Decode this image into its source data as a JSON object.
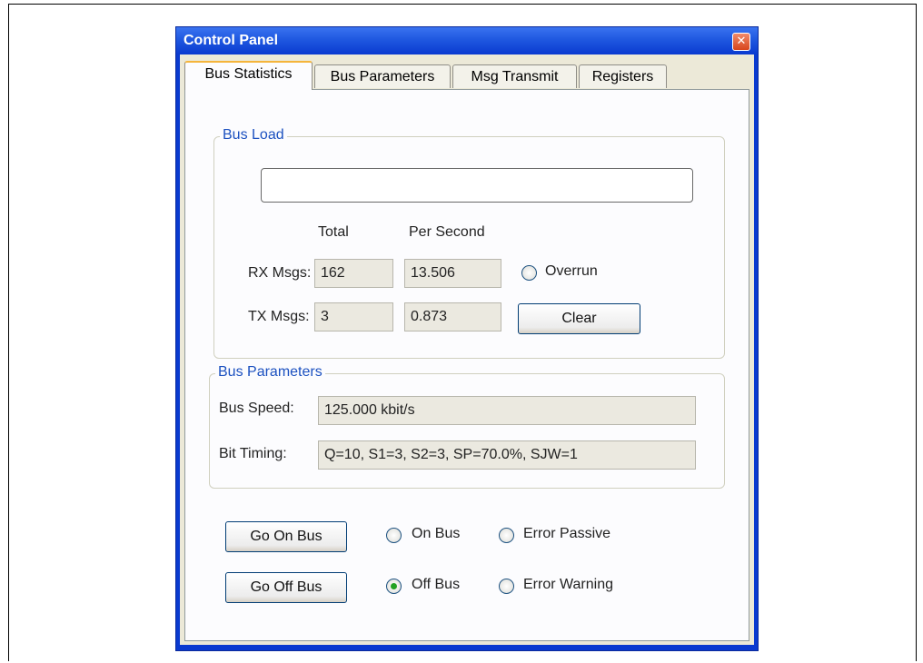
{
  "window": {
    "title": "Control Panel",
    "close_glyph": "✕"
  },
  "tabs": [
    {
      "label": "Bus Statistics",
      "active": true
    },
    {
      "label": "Bus Parameters",
      "active": false
    },
    {
      "label": "Msg Transmit",
      "active": false
    },
    {
      "label": "Registers",
      "active": false
    }
  ],
  "bus_load": {
    "group_label": "Bus Load",
    "progress_percent": 0,
    "col_total": "Total",
    "col_per_second": "Per Second",
    "rx_label": "RX Msgs:",
    "rx_total": "162",
    "rx_per_second": "13.506",
    "tx_label": "TX Msgs:",
    "tx_total": "3",
    "tx_per_second": "0.873",
    "overrun_label": "Overrun",
    "overrun_checked": false,
    "clear_button": "Clear"
  },
  "bus_parameters": {
    "group_label": "Bus Parameters",
    "speed_label": "Bus Speed:",
    "speed_value": "125.000 kbit/s",
    "timing_label": "Bit Timing:",
    "timing_value": "Q=10, S1=3, S2=3, SP=70.0%, SJW=1"
  },
  "bus_control": {
    "go_on_button": "Go On Bus",
    "go_off_button": "Go Off Bus",
    "on_bus_label": "On Bus",
    "off_bus_label": "Off Bus",
    "error_passive_label": "Error Passive",
    "error_warning_label": "Error Warning",
    "selected_state": "Off Bus"
  },
  "colors": {
    "titlebar": "#0a3ad0",
    "group_label": "#1c51c0",
    "radio_dot": "#21a121"
  }
}
